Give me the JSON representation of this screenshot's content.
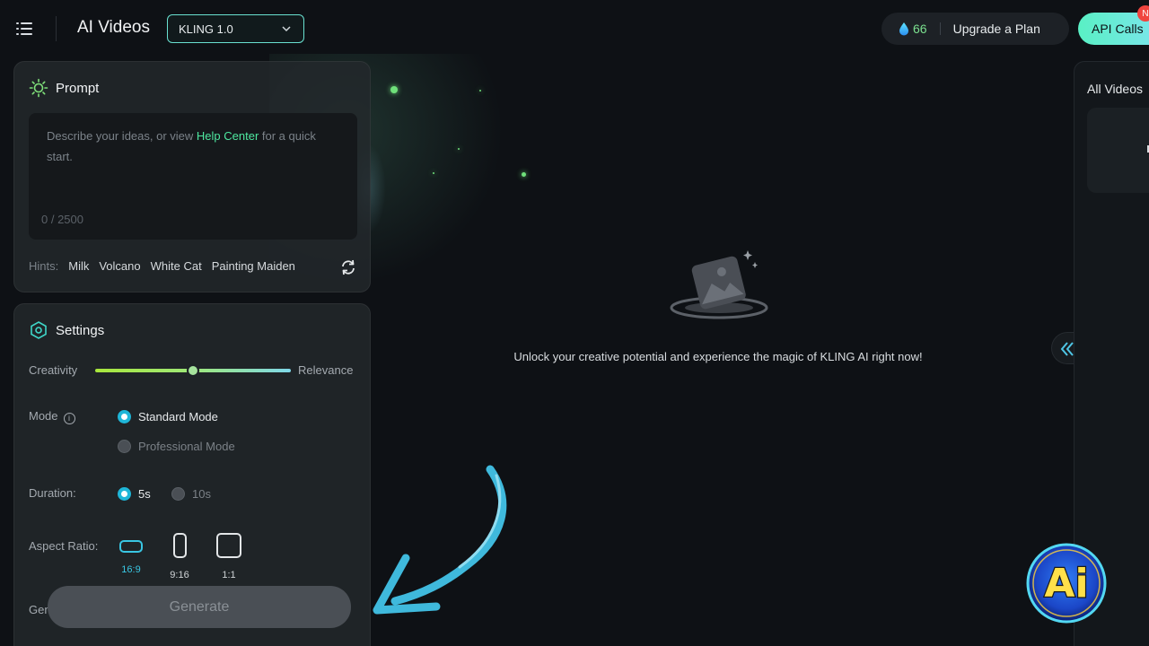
{
  "header": {
    "app_title": "AI Videos",
    "model_select": {
      "value": "KLING 1.0"
    },
    "credits": "66",
    "upgrade_label": "Upgrade a Plan",
    "api_label": "API Calls",
    "api_badge": "N"
  },
  "prompt": {
    "title": "Prompt",
    "placeholder_before": "Describe your ideas, or view ",
    "help_link": "Help Center",
    "placeholder_after": " for a quick start.",
    "char_count": "0 / 2500",
    "hints_label": "Hints:",
    "hints": [
      "Milk",
      "Volcano",
      "White Cat",
      "Painting Maiden"
    ]
  },
  "settings": {
    "title": "Settings",
    "creativity_label": "Creativity",
    "relevance_label": "Relevance",
    "creativity_relevance_value": 0.5,
    "mode_label": "Mode",
    "modes": [
      {
        "label": "Standard Mode",
        "selected": true
      },
      {
        "label": "Professional Mode",
        "selected": false
      }
    ],
    "duration_label": "Duration:",
    "durations": [
      {
        "label": "5s",
        "selected": true
      },
      {
        "label": "10s",
        "selected": false
      }
    ],
    "aspect_label": "Aspect Ratio:",
    "aspect_ratios": [
      {
        "label": "16:9",
        "selected": true
      },
      {
        "label": "9:16",
        "selected": false
      },
      {
        "label": "1:1",
        "selected": false
      }
    ],
    "partial_label": "Gen"
  },
  "generate_label": "Generate",
  "empty_state": {
    "message": "Unlock your creative potential and experience the magic of KLING AI right now!"
  },
  "right_panel": {
    "title": "All Videos"
  },
  "overlay": {
    "logo_text": "Ai"
  },
  "colors": {
    "accent_teal": "#39c6e3",
    "accent_green": "#4ee8a0",
    "background": "#0e1115"
  }
}
